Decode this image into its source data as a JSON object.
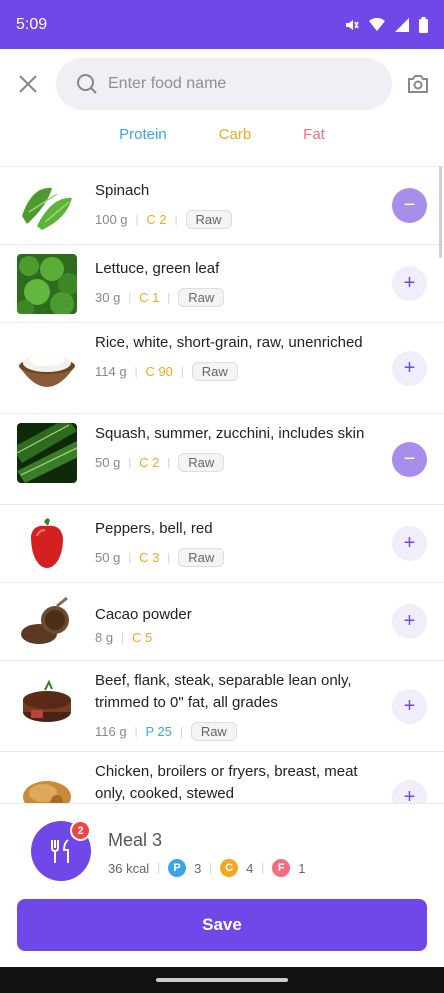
{
  "status": {
    "time": "5:09"
  },
  "search": {
    "placeholder": "Enter food name"
  },
  "tabs": [
    {
      "label": "Protein",
      "color": "#3AA5E6"
    },
    {
      "label": "Carb",
      "color": "#F5A623"
    },
    {
      "label": "Fat",
      "color": "#F26D7D"
    }
  ],
  "items": [
    {
      "name": "Spinach",
      "weight": "100 g",
      "macro": "C 2",
      "macro_type": "carb",
      "tag": "Raw",
      "action": "remove"
    },
    {
      "name": "Lettuce, green leaf",
      "weight": "30 g",
      "macro": "C 1",
      "macro_type": "carb",
      "tag": "Raw",
      "action": "add"
    },
    {
      "name": "Rice, white, short-grain, raw, unenriched",
      "weight": "114 g",
      "macro": "C 90",
      "macro_type": "carb",
      "tag": "Raw",
      "action": "add"
    },
    {
      "name": "Squash, summer, zucchini, includes skin",
      "weight": "50 g",
      "macro": "C 2",
      "macro_type": "carb",
      "tag": "Raw",
      "action": "remove"
    },
    {
      "name": "Peppers, bell, red",
      "weight": "50 g",
      "macro": "C 3",
      "macro_type": "carb",
      "tag": "Raw",
      "action": "add"
    },
    {
      "name": "Cacao powder",
      "weight": "8 g",
      "macro": "C 5",
      "macro_type": "carb",
      "tag": "",
      "action": "add"
    },
    {
      "name": "Beef, flank, steak, separable lean only, trimmed to 0\" fat, all grades",
      "weight": "116 g",
      "macro": "P 25",
      "macro_type": "protein",
      "tag": "Raw",
      "action": "add"
    },
    {
      "name": "Chicken, broilers or fryers, breast, meat only, cooked, stewed",
      "weight": "",
      "macro": "",
      "macro_type": "protein",
      "tag": "",
      "action": "add"
    }
  ],
  "meal": {
    "title": "Meal 3",
    "badge": "2",
    "kcal": "36 kcal",
    "protein_letter": "P",
    "protein": "3",
    "carb_letter": "C",
    "carb": "4",
    "fat_letter": "F",
    "fat": "1"
  },
  "save_label": "Save",
  "colors": {
    "accent": "#7048E8",
    "protein": "#3AA5E6",
    "carb": "#F5A623",
    "fat": "#F26D7D"
  }
}
